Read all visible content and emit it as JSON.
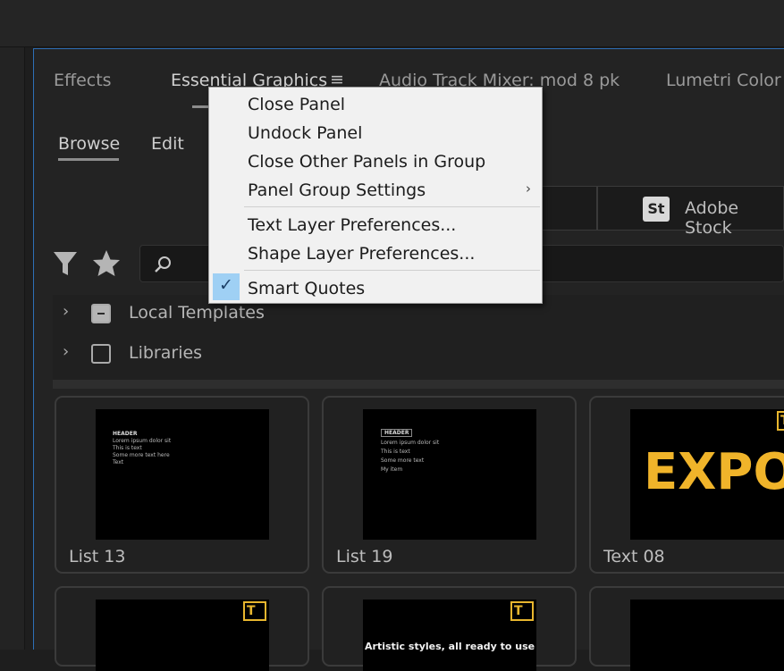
{
  "tabs": [
    {
      "label": "Effects"
    },
    {
      "label": "Essential Graphics"
    },
    {
      "label": "Audio Track Mixer: mod 8 pk"
    },
    {
      "label": "Lumetri Color"
    }
  ],
  "subtabs": [
    {
      "label": "Browse"
    },
    {
      "label": "Edit"
    }
  ],
  "stock": {
    "badge": "St",
    "label": "Adobe Stock"
  },
  "tree": [
    {
      "label": "Local Templates"
    },
    {
      "label": "Libraries"
    }
  ],
  "menu": {
    "items": [
      {
        "label": "Close Panel"
      },
      {
        "label": "Undock Panel"
      },
      {
        "label": "Close Other Panels in Group"
      },
      {
        "label": "Panel Group Settings",
        "submenu_glyph": "›"
      },
      {
        "label": "Text Layer Preferences..."
      },
      {
        "label": "Shape Layer Preferences..."
      },
      {
        "label": "Smart Quotes",
        "checked": true,
        "check_glyph": "✓"
      }
    ]
  },
  "templates": [
    {
      "label": "List 13",
      "thumb_header": "HEADER",
      "thumb_lines": [
        "Lorem ipsum dolor sit",
        "This is text",
        "Some more text here",
        "Text"
      ]
    },
    {
      "label": "List 19",
      "thumb_header": "HEADER",
      "thumb_lines": [
        "Lorem ipsum dolor sit",
        "This is text",
        "Some more text",
        "My item"
      ]
    },
    {
      "label": "Text 08",
      "thumb_text": "EXPO"
    },
    {
      "label": ""
    },
    {
      "label": "",
      "thumb_text": "Artistic styles, all ready to use"
    },
    {
      "label": ""
    }
  ],
  "colors": {
    "accent_blue": "#2d6fb6",
    "warning_gold": "#e8b62e",
    "menu_bg": "#f1f1f1",
    "check_highlight": "#9fd0f4"
  }
}
